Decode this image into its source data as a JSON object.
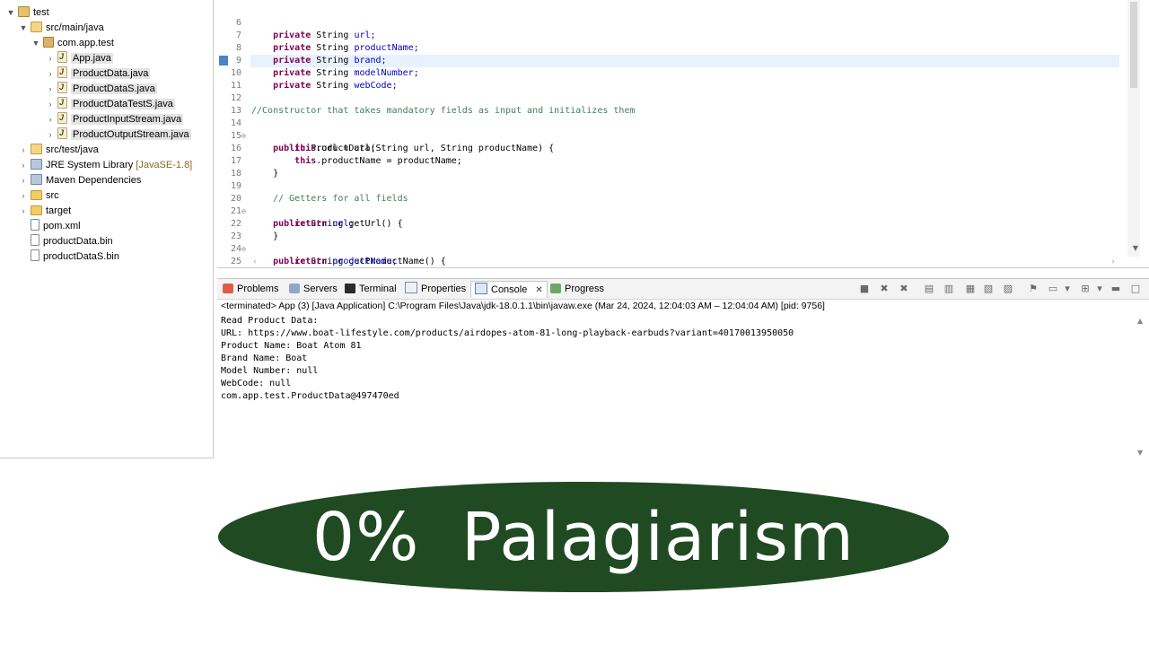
{
  "explorer": {
    "items": [
      {
        "label": "test"
      },
      {
        "label": "src/main/java"
      },
      {
        "label": "com.app.test"
      },
      {
        "label": "App.java"
      },
      {
        "label": "ProductData.java"
      },
      {
        "label": "ProductDataS.java"
      },
      {
        "label": "ProductDataTestS.java"
      },
      {
        "label": "ProductInputStream.java"
      },
      {
        "label": "ProductOutputStream.java"
      },
      {
        "label": "src/test/java"
      },
      {
        "label": "JRE System Library",
        "suffix": "[JavaSE-1.8]"
      },
      {
        "label": "Maven Dependencies"
      },
      {
        "label": "src"
      },
      {
        "label": "target"
      },
      {
        "label": "pom.xml"
      },
      {
        "label": "productData.bin"
      },
      {
        "label": "productDataS.bin"
      }
    ]
  },
  "editor": {
    "lines": [
      {
        "n": "6",
        "fold": ""
      },
      {
        "n": "7",
        "fold": ""
      },
      {
        "n": "8",
        "fold": ""
      },
      {
        "n": "9",
        "fold": ""
      },
      {
        "n": "10",
        "fold": ""
      },
      {
        "n": "11",
        "fold": ""
      },
      {
        "n": "12",
        "fold": ""
      },
      {
        "n": "13",
        "fold": ""
      },
      {
        "n": "14",
        "fold": "⊖"
      },
      {
        "n": "15",
        "fold": ""
      },
      {
        "n": "16",
        "fold": ""
      },
      {
        "n": "17",
        "fold": ""
      },
      {
        "n": "18",
        "fold": ""
      },
      {
        "n": "19",
        "fold": ""
      },
      {
        "n": "20",
        "fold": "⊖"
      },
      {
        "n": "21",
        "fold": ""
      },
      {
        "n": "22",
        "fold": ""
      },
      {
        "n": "23",
        "fold": "⊖"
      },
      {
        "n": "24",
        "fold": ""
      },
      {
        "n": "25",
        "fold": ""
      }
    ],
    "code": {
      "private": "private",
      "String": "String",
      "public": "public",
      "this": "this",
      "return": "return",
      "f_url": "url;",
      "f_productName": "productName;",
      "f_brand": "brand;",
      "f_modelNumber": "modelNumber;",
      "f_webCode": "webCode;",
      "comment_ctor": "//Constructor that takes mandatory fields as input and initializes them",
      "ctor_sig": "ProductData(String url, String productName) {",
      "this_url": ".url = url;",
      "this_pn": ".productName = productName;",
      "close": "}",
      "comment_getters": "// Getters for all fields",
      "getUrl_sig": "getUrl() {",
      "ret_url": "url;",
      "getProductName_sig": "getProductName() {",
      "ret_pn": "productName;"
    }
  },
  "console": {
    "tabs": [
      "Problems",
      "Servers",
      "Terminal",
      "Properties",
      "Console",
      "Progress"
    ],
    "close_glyph": "✕",
    "terminated": "<terminated> App (3) [Java Application] C:\\Program Files\\Java\\jdk-18.0.1.1\\bin\\javaw.exe  (Mar 24, 2024, 12:04:03 AM – 12:04:04 AM) [pid: 9756]",
    "output": [
      "Read Product Data:",
      "URL: https://www.boat-lifestyle.com/products/airdopes-atom-81-long-playback-earbuds?variant=40170013950050",
      "Product Name: Boat Atom 81",
      "Brand Name: Boat",
      "Model Number: null",
      "WebCode: null",
      "com.app.test.ProductData@497470ed"
    ]
  },
  "banner": {
    "text": "0% Palagiarism",
    "background": "#1f4a22",
    "color": "#ffffff"
  }
}
